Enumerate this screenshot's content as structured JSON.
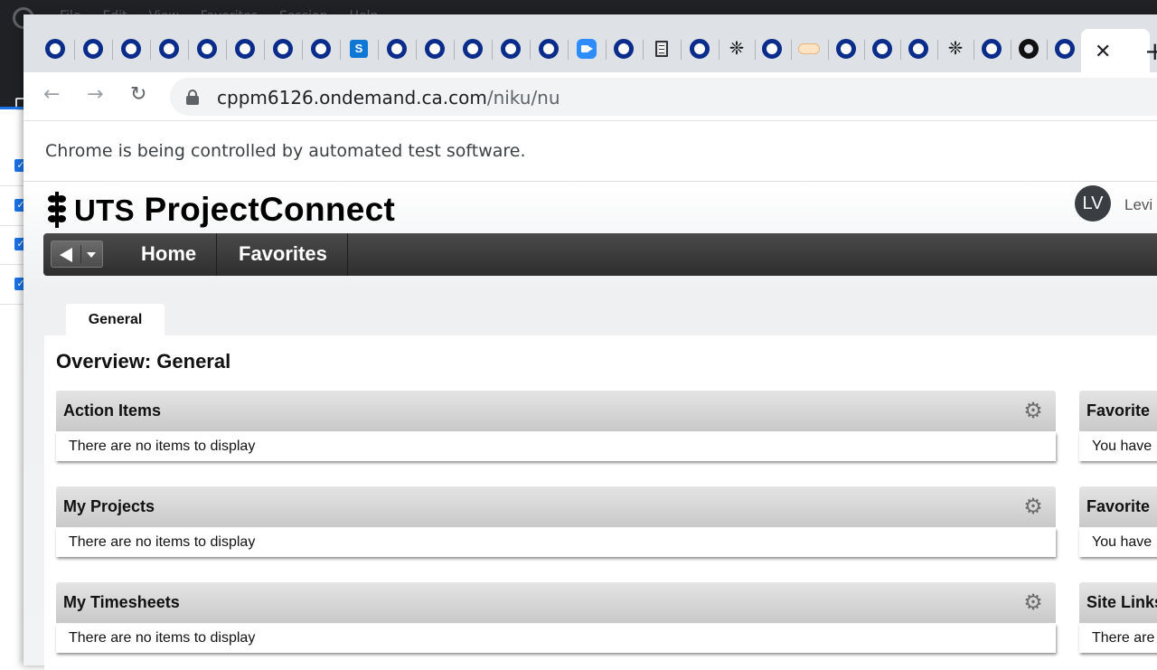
{
  "background_app": {
    "menu": [
      "File",
      "Edit",
      "View",
      "Favorites",
      "Session",
      "Help"
    ]
  },
  "browser": {
    "tabs": [
      {
        "icon": "ring-icon"
      },
      {
        "icon": "ring-icon"
      },
      {
        "icon": "ring-icon"
      },
      {
        "icon": "ring-icon"
      },
      {
        "icon": "ring-icon"
      },
      {
        "icon": "ring-icon"
      },
      {
        "icon": "ring-icon"
      },
      {
        "icon": "ring-icon"
      },
      {
        "icon": "sharepoint-icon",
        "glyph": "S"
      },
      {
        "icon": "ring-icon"
      },
      {
        "icon": "ring-icon"
      },
      {
        "icon": "ring-icon"
      },
      {
        "icon": "ring-icon"
      },
      {
        "icon": "ring-icon"
      },
      {
        "icon": "zoom-icon"
      },
      {
        "icon": "ring-icon"
      },
      {
        "icon": "document-icon"
      },
      {
        "icon": "ring-icon"
      },
      {
        "icon": "uts-crest-icon",
        "glyph": "❈"
      },
      {
        "icon": "ring-icon"
      },
      {
        "icon": "cloud-icon"
      },
      {
        "icon": "ring-icon"
      },
      {
        "icon": "ring-icon"
      },
      {
        "icon": "ring-icon"
      },
      {
        "icon": "uts-crest-icon",
        "glyph": "❈"
      },
      {
        "icon": "ring-icon"
      },
      {
        "icon": "github-icon"
      },
      {
        "icon": "ring-icon"
      }
    ],
    "active_tab_close": "✕",
    "new_tab": "+",
    "nav": {
      "back": "←",
      "forward": "→",
      "reload": "↻"
    },
    "url_host": "cppm6126.ondemand.ca.com",
    "url_path": "/niku/nu",
    "infobar": "Chrome is being controlled by automated test software."
  },
  "app": {
    "brand_prefix": "UTS",
    "brand_name": "ProjectConnect",
    "user_initials": "LV",
    "user_name": "Levi",
    "nav_items": [
      "Home",
      "Favorites"
    ],
    "page_tab": "General",
    "overview_title": "Overview: General",
    "portlets": [
      {
        "title": "Action Items",
        "empty": "There are no items to display"
      },
      {
        "title": "My Projects",
        "empty": "There are no items to display"
      },
      {
        "title": "My Timesheets",
        "empty": "There are no items to display"
      }
    ],
    "side_portlets": [
      {
        "title": "Favorite",
        "body": "You have"
      },
      {
        "title": "Favorite",
        "body": "You have"
      },
      {
        "title": "Site Links",
        "body": "There are"
      }
    ],
    "gear_glyph": "⚙"
  }
}
